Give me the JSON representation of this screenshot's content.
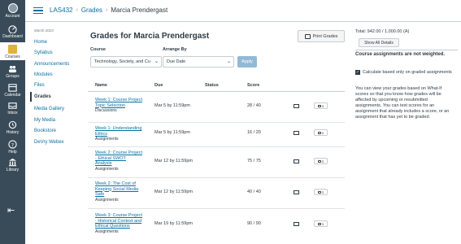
{
  "global_nav": {
    "items": [
      {
        "label": "Account",
        "icon": "account-avatar-icon"
      },
      {
        "label": "Dashboard",
        "icon": "dashboard-icon"
      },
      {
        "label": "Courses",
        "icon": "courses-icon"
      },
      {
        "label": "Groups",
        "icon": "groups-icon"
      },
      {
        "label": "Calendar",
        "icon": "calendar-icon"
      },
      {
        "label": "Inbox",
        "icon": "inbox-icon",
        "badge": "15"
      },
      {
        "label": "History",
        "icon": "history-icon"
      },
      {
        "label": "Help",
        "icon": "help-icon"
      },
      {
        "label": "Library",
        "icon": "library-icon"
      }
    ],
    "colors": {
      "background": "#394b58",
      "accent": "#e0b33e"
    }
  },
  "breadcrumbs": {
    "course": "LAS432",
    "section": "Grades",
    "current": "Marcia Prendergast"
  },
  "course_nav": {
    "term": "March 2023",
    "items": [
      "Home",
      "Syllabus",
      "Announcements",
      "Modules",
      "Files",
      "Grades",
      "Media Gallery",
      "My Media",
      "Bookstore",
      "DeVry Webex"
    ]
  },
  "main": {
    "title": "Grades for Marcia Prendergast",
    "print_label": "Print Grades",
    "course_label": "Course",
    "course_value": "Technology, Society, and Cu",
    "arrange_label": "Arrange By",
    "arrange_value": "Due Date",
    "apply_label": "Apply",
    "columns": {
      "name": "Name",
      "due": "Due",
      "status": "Status",
      "score": "Score"
    },
    "rows": [
      {
        "name_lines": [
          "Week 1: Course Project",
          "Topic Selection"
        ],
        "type": "Discussions",
        "due": "Mar 5 by 11:59pm",
        "score": "28 / 40",
        "comments": "1"
      },
      {
        "name_lines": [
          "Week 1: Understanding",
          "Ethics"
        ],
        "type": "Assignments",
        "due": "Mar 5 by 11:59pm",
        "score": "16 / 20",
        "comments": "1"
      },
      {
        "name_lines": [
          "Week 2: Course Project",
          "- Ethical SWOT",
          "Analysis"
        ],
        "type": "Assignments",
        "due": "Mar 12 by 11:59pm",
        "score": "75 / 75",
        "comments": "1"
      },
      {
        "name_lines": [
          "Week 2: The Cost of",
          "Keeping Social Media",
          "Safe"
        ],
        "type": "Assignments",
        "due": "Mar 12 by 11:59pm",
        "score": "40 / 40",
        "comments": "1"
      },
      {
        "name_lines": [
          "Week 3: Course Project",
          "- Historical Context and",
          "Ethical Questions"
        ],
        "type": "Assignments",
        "due": "Mar 19 by 11:59pm",
        "score": "90 / 90",
        "comments": "1"
      }
    ]
  },
  "sidebar": {
    "total": "Total: 942.00 / 1,000.00 (A)",
    "show_all_label": "Show All Details",
    "weighted_note": "Course assignments are not weighted.",
    "checkbox_label": "Calculate based only on graded assignments",
    "info_text": "You can view your grades based on What-If scores so that you know how grades will be affected by upcoming or resubmitted assignments. You can test scores for an assignment that already includes a score, or an assignment that has yet to be graded."
  }
}
